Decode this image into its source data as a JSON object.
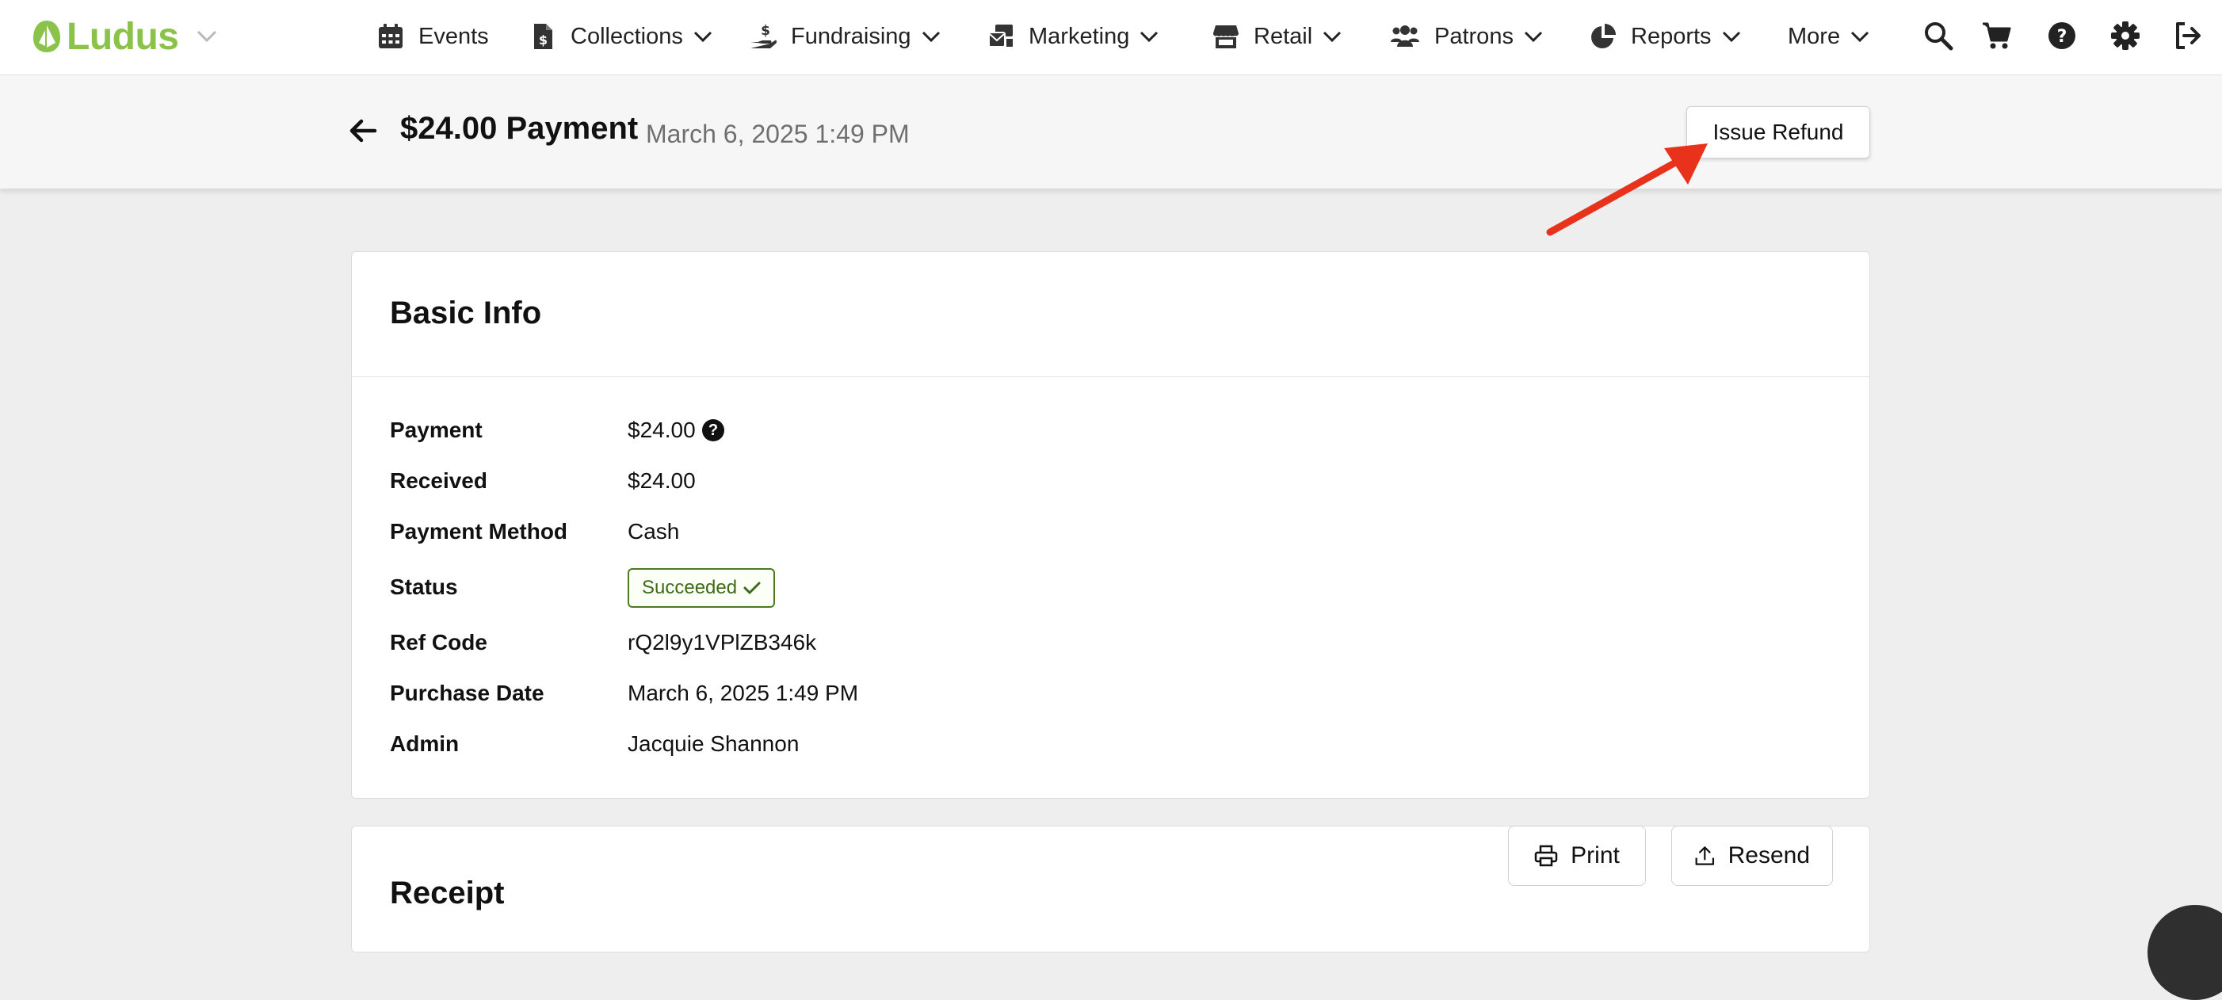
{
  "brand": {
    "name": "Ludus",
    "color": "#8bc34a"
  },
  "nav": {
    "items": [
      {
        "label": "Events",
        "icon": "calendar-icon"
      },
      {
        "label": "Collections",
        "icon": "document-dollar-icon"
      },
      {
        "label": "Fundraising",
        "icon": "hand-dollar-icon"
      },
      {
        "label": "Marketing",
        "icon": "mail-bulk-icon"
      },
      {
        "label": "Retail",
        "icon": "store-icon"
      },
      {
        "label": "Patrons",
        "icon": "users-icon"
      },
      {
        "label": "Reports",
        "icon": "pie-chart-icon"
      },
      {
        "label": "More",
        "icon": ""
      }
    ],
    "utilities": [
      "search-icon",
      "cart-icon",
      "help-icon",
      "gear-icon",
      "logout-icon"
    ]
  },
  "header": {
    "title": "$24.00 Payment",
    "subtitle": "March 6, 2025 1:49 PM",
    "refund_label": "Issue Refund"
  },
  "basic_info": {
    "title": "Basic Info",
    "rows": [
      {
        "label": "Payment",
        "value": "$24.00"
      },
      {
        "label": "Received",
        "value": "$24.00"
      },
      {
        "label": "Payment Method",
        "value": "Cash"
      },
      {
        "label": "Status",
        "value": "Succeeded"
      },
      {
        "label": "Ref Code",
        "value": "rQ2l9y1VPlZB346k"
      },
      {
        "label": "Purchase Date",
        "value": "March 6, 2025 1:49 PM"
      },
      {
        "label": "Admin",
        "value": "Jacquie Shannon"
      }
    ],
    "help_glyph": "?"
  },
  "receipt": {
    "title": "Receipt",
    "print_label": "Print",
    "resend_label": "Resend"
  },
  "colors": {
    "accent": "#8bc34a",
    "status_green": "#4a7a22",
    "annotation_red": "#e8321c"
  }
}
